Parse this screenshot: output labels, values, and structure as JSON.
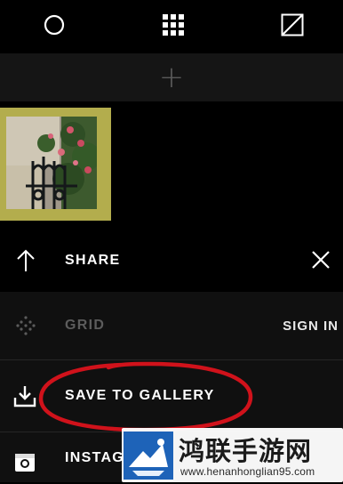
{
  "toolbar": {
    "icons": [
      "circle-icon",
      "grid-icon",
      "edit-square-icon"
    ]
  },
  "add_bar": {
    "symbol": "+"
  },
  "menu": {
    "share_label": "SHARE",
    "grid_label": "GRID",
    "sign_in_label": "SIGN IN",
    "save_label": "SAVE TO GALLERY",
    "instagram_label": "INSTAG"
  },
  "colors": {
    "background": "#000000",
    "row_background": "#101010",
    "photo_frame": "#b3ad4d",
    "grid_disabled": "#5c5c5c",
    "annotation": "#d0121b"
  },
  "watermark": {
    "title": "鸿联手游网",
    "url": "www.henanhonglian95.com"
  }
}
